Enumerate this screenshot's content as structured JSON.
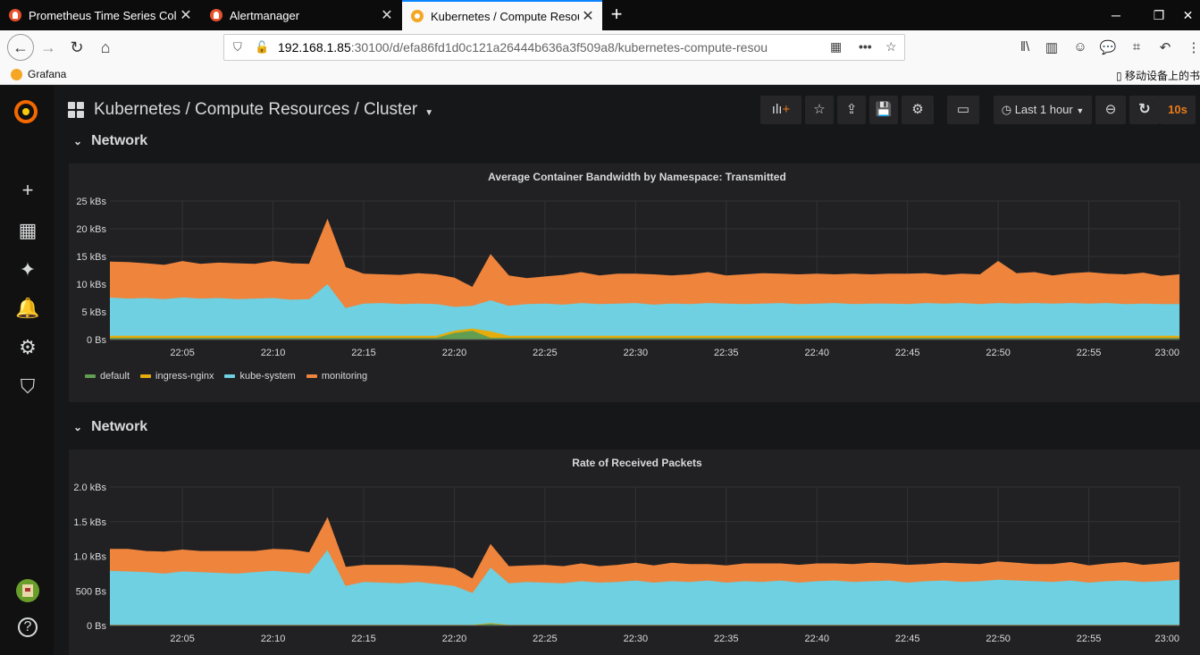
{
  "browser": {
    "tabs": [
      {
        "label": "Prometheus Time Series Colle",
        "icon": "prometheus-icon",
        "active": false
      },
      {
        "label": "Alertmanager",
        "icon": "prometheus-icon",
        "active": false
      },
      {
        "label": "Kubernetes / Compute Resou",
        "icon": "grafana-icon",
        "active": true
      }
    ],
    "url_host": "192.168.1.85",
    "url_rest": ":30100/d/efa86fd1d0c121a26444b636a3f509a8/kubernetes-compute-resou",
    "bookmark": "Grafana",
    "mobile_bookmarks": "移动设备上的书"
  },
  "dashboard": {
    "title": "Kubernetes / Compute Resources / Cluster",
    "time_range": "Last 1 hour",
    "refresh": "10s"
  },
  "rows": [
    {
      "title": "Network"
    },
    {
      "title": "Network"
    }
  ],
  "colors": {
    "default": "#629e51",
    "ingress-nginx": "#e5ac0e",
    "kube-system": "#6ed0e0",
    "monitoring": "#ef843c",
    "panel_bg": "#212124",
    "page_bg": "#161719"
  },
  "chart_data": [
    {
      "type": "area",
      "title": "Average Container Bandwidth by Namespace: Transmitted",
      "stacked": true,
      "x_ticks": [
        "22:05",
        "22:10",
        "22:15",
        "22:20",
        "22:25",
        "22:30",
        "22:35",
        "22:40",
        "22:45",
        "22:50",
        "22:55",
        "23:00"
      ],
      "y_ticks": [
        "0 Bs",
        "5 kBs",
        "10 kBs",
        "15 kBs",
        "20 kBs",
        "25 kBs"
      ],
      "ylim": [
        0,
        25000
      ],
      "x": [
        "22:01",
        "22:02",
        "22:03",
        "22:04",
        "22:05",
        "22:06",
        "22:07",
        "22:08",
        "22:09",
        "22:10",
        "22:11",
        "22:12",
        "22:13",
        "22:14",
        "22:15",
        "22:16",
        "22:17",
        "22:18",
        "22:19",
        "22:20",
        "22:21",
        "22:22",
        "22:23",
        "22:24",
        "22:25",
        "22:26",
        "22:27",
        "22:28",
        "22:29",
        "22:30",
        "22:31",
        "22:32",
        "22:33",
        "22:34",
        "22:35",
        "22:36",
        "22:37",
        "22:38",
        "22:39",
        "22:40",
        "22:41",
        "22:42",
        "22:43",
        "22:44",
        "22:45",
        "22:46",
        "22:47",
        "22:48",
        "22:49",
        "22:50",
        "22:51",
        "22:52",
        "22:53",
        "22:54",
        "22:55",
        "22:56",
        "22:57",
        "22:58",
        "22:59",
        "23:00"
      ],
      "series": [
        {
          "name": "default",
          "values": [
            300,
            300,
            300,
            300,
            300,
            300,
            300,
            300,
            300,
            300,
            300,
            300,
            300,
            300,
            300,
            300,
            300,
            300,
            300,
            1200,
            1600,
            300,
            300,
            300,
            300,
            300,
            300,
            300,
            300,
            300,
            300,
            300,
            300,
            300,
            300,
            300,
            300,
            300,
            300,
            300,
            300,
            300,
            300,
            300,
            300,
            300,
            300,
            300,
            300,
            300,
            300,
            300,
            300,
            300,
            300,
            300,
            300,
            300,
            300,
            300
          ]
        },
        {
          "name": "ingress-nginx",
          "values": [
            400,
            400,
            400,
            400,
            400,
            400,
            400,
            400,
            400,
            400,
            400,
            400,
            400,
            400,
            400,
            400,
            400,
            400,
            400,
            400,
            400,
            1200,
            400,
            400,
            400,
            400,
            400,
            400,
            400,
            400,
            400,
            400,
            400,
            400,
            400,
            400,
            400,
            400,
            400,
            400,
            400,
            400,
            400,
            400,
            400,
            400,
            400,
            400,
            400,
            400,
            400,
            400,
            400,
            400,
            400,
            400,
            400,
            400,
            400,
            400
          ]
        },
        {
          "name": "kube-system",
          "values": [
            6900,
            6700,
            6800,
            6600,
            6900,
            6700,
            6800,
            6600,
            6700,
            6800,
            6500,
            6600,
            9300,
            5000,
            5800,
            5900,
            5700,
            5800,
            5700,
            4300,
            4100,
            5600,
            5400,
            5700,
            5800,
            5600,
            5900,
            5700,
            5800,
            5900,
            5600,
            5800,
            5700,
            5900,
            5800,
            5700,
            5800,
            5900,
            5700,
            5800,
            5900,
            5700,
            5800,
            5800,
            5700,
            5900,
            5800,
            5900,
            5700,
            5900,
            5800,
            5900,
            5800,
            5900,
            5800,
            5900,
            5700,
            5800,
            5700,
            5700
          ]
        },
        {
          "name": "monitoring",
          "values": [
            6400,
            6500,
            6200,
            6100,
            6500,
            6200,
            6300,
            6400,
            6200,
            6600,
            6500,
            6300,
            11600,
            7300,
            5300,
            5100,
            5200,
            5400,
            5300,
            5200,
            3300,
            8200,
            5400,
            4600,
            4800,
            5300,
            5500,
            5100,
            5300,
            5200,
            5400,
            5000,
            5300,
            5500,
            5000,
            5300,
            5400,
            5200,
            5300,
            5300,
            5100,
            5400,
            5200,
            5300,
            5400,
            5300,
            5100,
            5200,
            5300,
            7500,
            5400,
            5500,
            5000,
            5300,
            5600,
            5200,
            5300,
            5500,
            5000,
            5300
          ]
        }
      ],
      "legend": [
        "default",
        "ingress-nginx",
        "kube-system",
        "monitoring"
      ],
      "legend_position": "bottom-left",
      "grid": true
    },
    {
      "type": "area",
      "title": "Rate of Received Packets",
      "stacked": true,
      "x_ticks": [
        "22:05",
        "22:10",
        "22:15",
        "22:20",
        "22:25",
        "22:30",
        "22:35",
        "22:40",
        "22:45",
        "22:50",
        "22:55",
        "23:00"
      ],
      "y_ticks": [
        "0 Bs",
        "500 Bs",
        "1.0 kBs",
        "1.5 kBs",
        "2.0 kBs"
      ],
      "ylim": [
        0,
        2000
      ],
      "x": [
        "22:01",
        "22:02",
        "22:03",
        "22:04",
        "22:05",
        "22:06",
        "22:07",
        "22:08",
        "22:09",
        "22:10",
        "22:11",
        "22:12",
        "22:13",
        "22:14",
        "22:15",
        "22:16",
        "22:17",
        "22:18",
        "22:19",
        "22:20",
        "22:21",
        "22:22",
        "22:23",
        "22:24",
        "22:25",
        "22:26",
        "22:27",
        "22:28",
        "22:29",
        "22:30",
        "22:31",
        "22:32",
        "22:33",
        "22:34",
        "22:35",
        "22:36",
        "22:37",
        "22:38",
        "22:39",
        "22:40",
        "22:41",
        "22:42",
        "22:43",
        "22:44",
        "22:45",
        "22:46",
        "22:47",
        "22:48",
        "22:49",
        "22:50",
        "22:51",
        "22:52",
        "22:53",
        "22:54",
        "22:55",
        "22:56",
        "22:57",
        "22:58",
        "22:59",
        "23:00"
      ],
      "series": [
        {
          "name": "default",
          "values": [
            5,
            5,
            5,
            5,
            5,
            5,
            5,
            5,
            5,
            5,
            5,
            5,
            5,
            5,
            5,
            5,
            5,
            5,
            5,
            5,
            5,
            30,
            5,
            5,
            5,
            5,
            5,
            5,
            5,
            5,
            5,
            5,
            5,
            5,
            5,
            5,
            5,
            5,
            5,
            5,
            5,
            5,
            5,
            5,
            5,
            5,
            5,
            5,
            5,
            5,
            5,
            5,
            5,
            5,
            5,
            5,
            5,
            5,
            5,
            5
          ]
        },
        {
          "name": "ingress-nginx",
          "values": [
            5,
            5,
            5,
            5,
            5,
            5,
            5,
            5,
            5,
            5,
            5,
            5,
            5,
            5,
            5,
            5,
            5,
            5,
            5,
            5,
            5,
            5,
            5,
            5,
            5,
            5,
            5,
            5,
            5,
            5,
            5,
            5,
            5,
            5,
            5,
            5,
            5,
            5,
            5,
            5,
            5,
            5,
            5,
            5,
            5,
            5,
            5,
            5,
            5,
            5,
            5,
            5,
            5,
            5,
            5,
            5,
            5,
            5,
            5,
            5
          ]
        },
        {
          "name": "kube-system",
          "values": [
            780,
            770,
            760,
            740,
            770,
            760,
            750,
            740,
            760,
            780,
            760,
            740,
            1080,
            560,
            620,
            610,
            600,
            620,
            590,
            560,
            460,
            800,
            600,
            620,
            610,
            600,
            630,
            610,
            620,
            640,
            610,
            630,
            620,
            640,
            610,
            630,
            620,
            640,
            610,
            630,
            640,
            620,
            630,
            640,
            610,
            630,
            640,
            620,
            630,
            650,
            640,
            630,
            620,
            640,
            610,
            630,
            640,
            620,
            630,
            650
          ]
        },
        {
          "name": "monitoring",
          "values": [
            310,
            320,
            300,
            310,
            310,
            300,
            310,
            320,
            300,
            310,
            320,
            300,
            460,
            270,
            240,
            250,
            260,
            230,
            250,
            250,
            200,
            330,
            240,
            230,
            250,
            240,
            250,
            230,
            240,
            250,
            240,
            260,
            250,
            230,
            240,
            250,
            260,
            240,
            250,
            250,
            240,
            250,
            260,
            240,
            250,
            240,
            250,
            260,
            240,
            260,
            250,
            240,
            250,
            260,
            240,
            250,
            260,
            240,
            250,
            260
          ]
        }
      ],
      "grid": true
    }
  ]
}
